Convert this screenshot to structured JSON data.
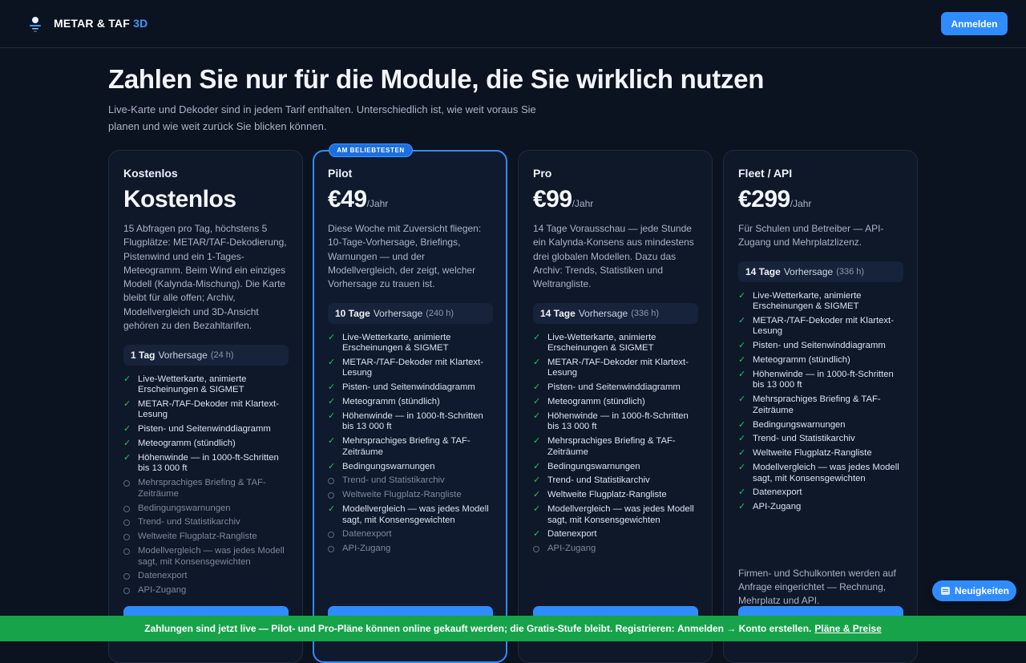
{
  "header": {
    "brand_main": "METAR & TAF",
    "brand_accent": "3D",
    "login_label": "Anmelden"
  },
  "hero": {
    "title": "Zahlen Sie nur für die Module, die Sie wirklich nutzen",
    "subtitle": "Live-Karte und Dekoder sind in jedem Tarif enthalten. Unterschiedlich ist, wie weit voraus Sie planen und wie weit zurück Sie blicken können."
  },
  "plans": [
    {
      "name": "Kostenlos",
      "price": "Kostenlos",
      "per": "",
      "description": "15 Abfragen pro Tag, höchstens 5 Flugplätze: METAR/TAF-Dekodierung, Pistenwind und ein 1-Tages-Meteogramm. Beim Wind ein einziges Modell (Kalynda-Mischung). Die Karte bleibt für alle offen; Archiv, Modellvergleich und 3D-Ansicht gehören zu den Bezahltarifen.",
      "horizon_bold": "1 Tag",
      "horizon_text": "Vorhersage",
      "horizon_hours": "(24 h)",
      "features": [
        {
          "label": "Live-Wetterkarte, animierte Erscheinungen & SIGMET",
          "included": true
        },
        {
          "label": "METAR-/TAF-Dekoder mit Klartext-Lesung",
          "included": true
        },
        {
          "label": "Pisten- und Seitenwinddiagramm",
          "included": true
        },
        {
          "label": "Meteogramm (stündlich)",
          "included": true
        },
        {
          "label": "Höhenwinde — in 1000-ft-Schritten bis 13 000 ft",
          "included": true
        },
        {
          "label": "Mehrsprachiges Briefing & TAF-Zeiträume",
          "included": false
        },
        {
          "label": "Bedingungswarnungen",
          "included": false
        },
        {
          "label": "Trend- und Statistikarchiv",
          "included": false
        },
        {
          "label": "Weltweite Flugplatz-Rangliste",
          "included": false
        },
        {
          "label": "Modellvergleich — was jedes Modell sagt, mit Konsensgewichten",
          "included": false
        },
        {
          "label": "Datenexport",
          "included": false
        },
        {
          "label": "API-Zugang",
          "included": false
        }
      ]
    },
    {
      "name": "Pilot",
      "price": "€49",
      "per": "/Jahr",
      "badge": "AM BELIEBTESTEN",
      "description": "Diese Woche mit Zuversicht fliegen: 10-Tage-Vorhersage, Briefings, Warnungen — und der Modellvergleich, der zeigt, welcher Vorhersage zu trauen ist.",
      "horizon_bold": "10 Tage",
      "horizon_text": "Vorhersage",
      "horizon_hours": "(240 h)",
      "features": [
        {
          "label": "Live-Wetterkarte, animierte Erscheinungen & SIGMET",
          "included": true
        },
        {
          "label": "METAR-/TAF-Dekoder mit Klartext-Lesung",
          "included": true
        },
        {
          "label": "Pisten- und Seitenwinddiagramm",
          "included": true
        },
        {
          "label": "Meteogramm (stündlich)",
          "included": true
        },
        {
          "label": "Höhenwinde — in 1000-ft-Schritten bis 13 000 ft",
          "included": true
        },
        {
          "label": "Mehrsprachiges Briefing & TAF-Zeiträume",
          "included": true
        },
        {
          "label": "Bedingungswarnungen",
          "included": true
        },
        {
          "label": "Trend- und Statistikarchiv",
          "included": false
        },
        {
          "label": "Weltweite Flugplatz-Rangliste",
          "included": false
        },
        {
          "label": "Modellvergleich — was jedes Modell sagt, mit Konsensgewichten",
          "included": true
        },
        {
          "label": "Datenexport",
          "included": false
        },
        {
          "label": "API-Zugang",
          "included": false
        }
      ]
    },
    {
      "name": "Pro",
      "price": "€99",
      "per": "/Jahr",
      "description": "14 Tage Vorausschau — jede Stunde ein Kalynda-Konsens aus mindestens drei globalen Modellen. Dazu das Archiv: Trends, Statistiken und Weltrangliste.",
      "horizon_bold": "14 Tage",
      "horizon_text": "Vorhersage",
      "horizon_hours": "(336 h)",
      "features": [
        {
          "label": "Live-Wetterkarte, animierte Erscheinungen & SIGMET",
          "included": true
        },
        {
          "label": "METAR-/TAF-Dekoder mit Klartext-Lesung",
          "included": true
        },
        {
          "label": "Pisten- und Seitenwinddiagramm",
          "included": true
        },
        {
          "label": "Meteogramm (stündlich)",
          "included": true
        },
        {
          "label": "Höhenwinde — in 1000-ft-Schritten bis 13 000 ft",
          "included": true
        },
        {
          "label": "Mehrsprachiges Briefing & TAF-Zeiträume",
          "included": true
        },
        {
          "label": "Bedingungswarnungen",
          "included": true
        },
        {
          "label": "Trend- und Statistikarchiv",
          "included": true
        },
        {
          "label": "Weltweite Flugplatz-Rangliste",
          "included": true
        },
        {
          "label": "Modellvergleich — was jedes Modell sagt, mit Konsensgewichten",
          "included": true
        },
        {
          "label": "Datenexport",
          "included": true
        },
        {
          "label": "API-Zugang",
          "included": false
        }
      ]
    },
    {
      "name": "Fleet / API",
      "price": "€299",
      "per": "/Jahr",
      "description": "Für Schulen und Betreiber — API-Zugang und Mehrplatzlizenz.",
      "horizon_bold": "14 Tage",
      "horizon_text": "Vorhersage",
      "horizon_hours": "(336 h)",
      "note": "Firmen- und Schulkonten werden auf Anfrage eingerichtet — Rechnung, Mehrplatz und API.",
      "features": [
        {
          "label": "Live-Wetterkarte, animierte Erscheinungen & SIGMET",
          "included": true
        },
        {
          "label": "METAR-/TAF-Dekoder mit Klartext-Lesung",
          "included": true
        },
        {
          "label": "Pisten- und Seitenwinddiagramm",
          "included": true
        },
        {
          "label": "Meteogramm (stündlich)",
          "included": true
        },
        {
          "label": "Höhenwinde — in 1000-ft-Schritten bis 13 000 ft",
          "included": true
        },
        {
          "label": "Mehrsprachiges Briefing & TAF-Zeiträume",
          "included": true
        },
        {
          "label": "Bedingungswarnungen",
          "included": true
        },
        {
          "label": "Trend- und Statistikarchiv",
          "included": true
        },
        {
          "label": "Weltweite Flugplatz-Rangliste",
          "included": true
        },
        {
          "label": "Modellvergleich — was jedes Modell sagt, mit Konsensgewichten",
          "included": true
        },
        {
          "label": "Datenexport",
          "included": true
        },
        {
          "label": "API-Zugang",
          "included": true
        }
      ]
    }
  ],
  "news_label": "Neuigkeiten",
  "banner": {
    "part1": "Zahlungen sind ",
    "part2": "jetzt live",
    "part3": " — Pilot- und Pro-Pläne können online gekauft werden; die Gratis-Stufe bleibt. Registrieren: ",
    "part4": "Anmelden → Konto erstellen",
    "part5": ".",
    "link": "Pläne & Preise"
  },
  "colors": {
    "accent": "#2f8cff",
    "check": "#22c55e",
    "banner": "#16a34a",
    "background": "#0b1220"
  }
}
